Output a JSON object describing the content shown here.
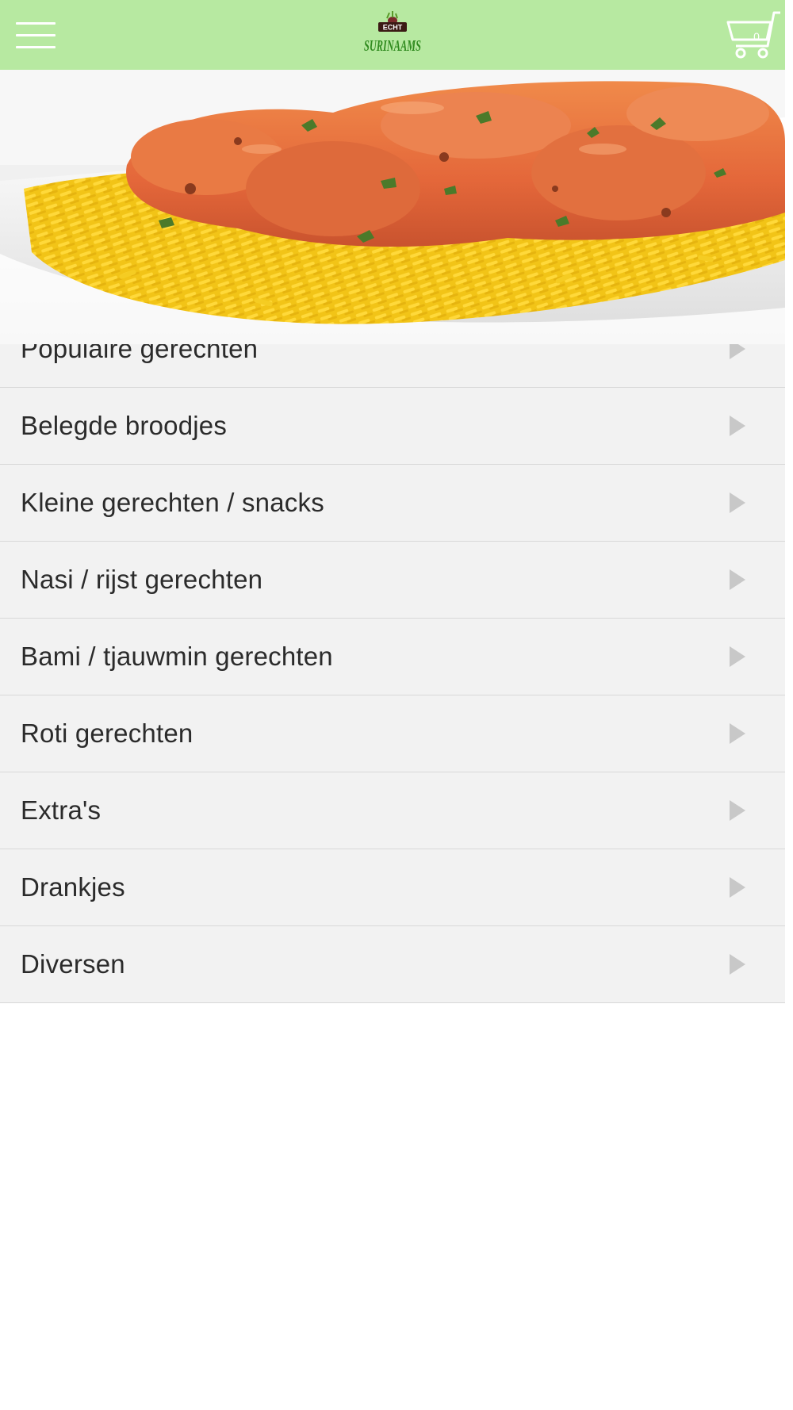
{
  "header": {
    "logo_text_top": "ECHT",
    "logo_text_main": "SURINAAMS",
    "cart_count": "0",
    "colors": {
      "background": "#b7e9a1",
      "icon": "#ffffff"
    },
    "icons": {
      "menu": "hamburger-menu-icon",
      "cart": "shopping-cart-icon"
    }
  },
  "hero": {
    "icon": "food-photo-chicken-curry-rice"
  },
  "categories": [
    {
      "label": "Populaire gerechten"
    },
    {
      "label": "Belegde broodjes"
    },
    {
      "label": "Kleine gerechten / snacks"
    },
    {
      "label": "Nasi / rijst gerechten"
    },
    {
      "label": "Bami / tjauwmin gerechten"
    },
    {
      "label": "Roti gerechten"
    },
    {
      "label": "Extra's"
    },
    {
      "label": "Drankjes"
    },
    {
      "label": "Diversen"
    }
  ]
}
